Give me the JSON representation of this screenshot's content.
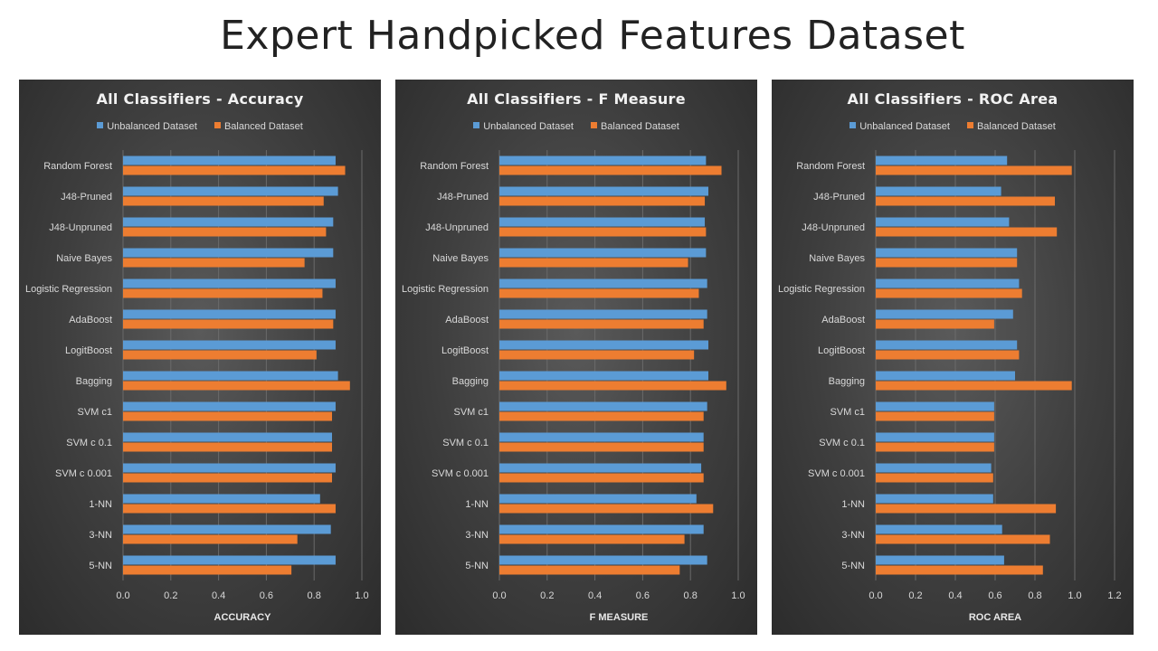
{
  "slide": {
    "title": "Expert Handpicked Features Dataset"
  },
  "colors": {
    "unbalanced": "#5b9bd5",
    "balanced": "#ed7d31"
  },
  "chart_data": [
    {
      "type": "bar",
      "orientation": "horizontal",
      "title": "All Classifiers - Accuracy",
      "xlabel": "ACCURACY",
      "ylabel": "",
      "xlim": [
        0,
        1.0
      ],
      "ticks": [
        "0.0",
        "0.2",
        "0.4",
        "0.6",
        "0.8",
        "1.0"
      ],
      "tick_values": [
        0,
        0.2,
        0.4,
        0.6,
        0.8,
        1.0
      ],
      "grid": true,
      "legend": "top",
      "categories": [
        "Random Forest",
        "J48-Pruned",
        "J48-Unpruned",
        "Naive Bayes",
        "Logistic Regression",
        "AdaBoost",
        "LogitBoost",
        "Bagging",
        "SVM c1",
        "SVM c 0.1",
        "SVM c 0.001",
        "1-NN",
        "3-NN",
        "5-NN"
      ],
      "series": [
        {
          "name": "Unbalanced Dataset",
          "values": [
            0.89,
            0.9,
            0.88,
            0.88,
            0.89,
            0.89,
            0.89,
            0.9,
            0.89,
            0.875,
            0.89,
            0.825,
            0.87,
            0.89
          ]
        },
        {
          "name": "Balanced Dataset",
          "values": [
            0.93,
            0.84,
            0.85,
            0.76,
            0.835,
            0.88,
            0.81,
            0.95,
            0.875,
            0.875,
            0.875,
            0.89,
            0.73,
            0.705
          ]
        }
      ]
    },
    {
      "type": "bar",
      "orientation": "horizontal",
      "title": "All Classifiers - F Measure",
      "xlabel": "F MEASURE",
      "ylabel": "",
      "xlim": [
        0,
        1.0
      ],
      "ticks": [
        "0.0",
        "0.2",
        "0.4",
        "0.6",
        "0.8",
        "1.0"
      ],
      "tick_values": [
        0,
        0.2,
        0.4,
        0.6,
        0.8,
        1.0
      ],
      "grid": true,
      "legend": "top",
      "categories": [
        "Random Forest",
        "J48-Pruned",
        "J48-Unpruned",
        "Naive Bayes",
        "Logistic Regression",
        "AdaBoost",
        "LogitBoost",
        "Bagging",
        "SVM c1",
        "SVM c 0.1",
        "SVM c 0.001",
        "1-NN",
        "3-NN",
        "5-NN"
      ],
      "series": [
        {
          "name": "Unbalanced Dataset",
          "values": [
            0.865,
            0.875,
            0.86,
            0.865,
            0.87,
            0.87,
            0.875,
            0.875,
            0.87,
            0.855,
            0.845,
            0.825,
            0.855,
            0.87
          ]
        },
        {
          "name": "Balanced Dataset",
          "values": [
            0.93,
            0.86,
            0.865,
            0.79,
            0.835,
            0.855,
            0.815,
            0.95,
            0.855,
            0.855,
            0.855,
            0.895,
            0.775,
            0.755
          ]
        }
      ]
    },
    {
      "type": "bar",
      "orientation": "horizontal",
      "title": "All Classifiers - ROC Area",
      "xlabel": "ROC AREA",
      "ylabel": "",
      "xlim": [
        0,
        1.2
      ],
      "ticks": [
        "0.0",
        "0.2",
        "0.4",
        "0.6",
        "0.8",
        "1.0",
        "1.2"
      ],
      "tick_values": [
        0,
        0.2,
        0.4,
        0.6,
        0.8,
        1.0,
        1.2
      ],
      "grid": true,
      "legend": "top",
      "categories": [
        "Random Forest",
        "J48-Pruned",
        "J48-Unpruned",
        "Naive Bayes",
        "Logistic Regression",
        "AdaBoost",
        "LogitBoost",
        "Bagging",
        "SVM c1",
        "SVM c 0.1",
        "SVM c 0.001",
        "1-NN",
        "3-NN",
        "5-NN"
      ],
      "series": [
        {
          "name": "Unbalanced Dataset",
          "values": [
            0.66,
            0.63,
            0.67,
            0.71,
            0.72,
            0.69,
            0.71,
            0.7,
            0.595,
            0.595,
            0.58,
            0.59,
            0.635,
            0.645
          ]
        },
        {
          "name": "Balanced Dataset",
          "values": [
            0.985,
            0.9,
            0.91,
            0.71,
            0.735,
            0.595,
            0.72,
            0.985,
            0.595,
            0.595,
            0.59,
            0.905,
            0.875,
            0.84
          ]
        }
      ]
    }
  ]
}
